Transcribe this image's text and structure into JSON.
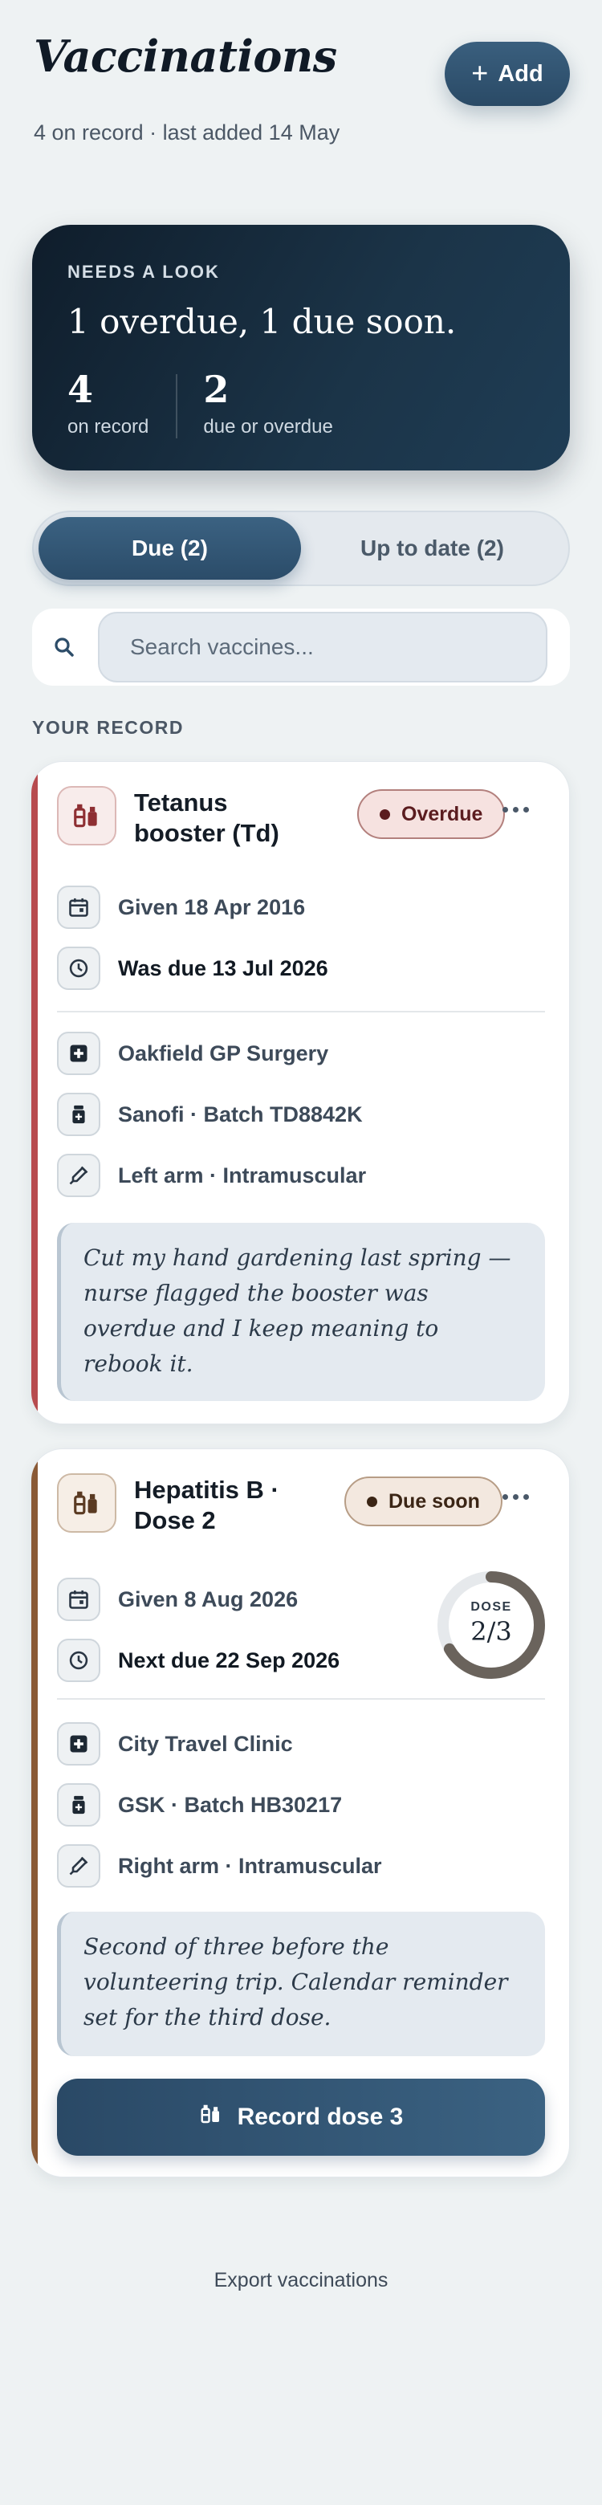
{
  "header": {
    "title": "Vaccinations",
    "subtitle": "4 on record · last added 14 May",
    "add_label": "Add"
  },
  "summary": {
    "eyebrow": "NEEDS A LOOK",
    "headline": "1 overdue, 1 due soon.",
    "stats": [
      {
        "value": "4",
        "label": "on record"
      },
      {
        "value": "2",
        "label": "due or overdue"
      }
    ]
  },
  "tabs": [
    {
      "label": "Due (2)",
      "active": true
    },
    {
      "label": "Up to date (2)",
      "active": false
    }
  ],
  "search": {
    "placeholder": "Search vaccines..."
  },
  "section_label": "YOUR RECORD",
  "cards": [
    {
      "title": "Tetanus booster (Td)",
      "status": "Overdue",
      "given": "Given 18 Apr 2016",
      "due": "Was due 13 Jul 2026",
      "clinic": "Oakfield GP Surgery",
      "batch": "Sanofi · Batch TD8842K",
      "site": "Left arm · Intramuscular",
      "note": "Cut my hand gardening last spring — nurse flagged the booster was overdue and I keep meaning to rebook it."
    },
    {
      "title": "Hepatitis B · Dose 2",
      "status": "Due soon",
      "given": "Given 8 Aug 2026",
      "due": "Next due 22 Sep 2026",
      "dose_label": "DOSE",
      "dose_value": "2/3",
      "dose_fraction": 0.667,
      "clinic": "City Travel Clinic",
      "batch": "GSK · Batch HB30217",
      "site": "Right arm · Intramuscular",
      "note": "Second of three before the volunteering trip. Calendar reminder set for the third dose.",
      "action_label": "Record dose 3"
    }
  ],
  "footer": {
    "export_label": "Export vaccinations"
  },
  "colors": {
    "accent": "#2b4c69",
    "overdue": "#b74b4f",
    "due_soon": "#8a5a36",
    "background": "#eef2f3"
  }
}
